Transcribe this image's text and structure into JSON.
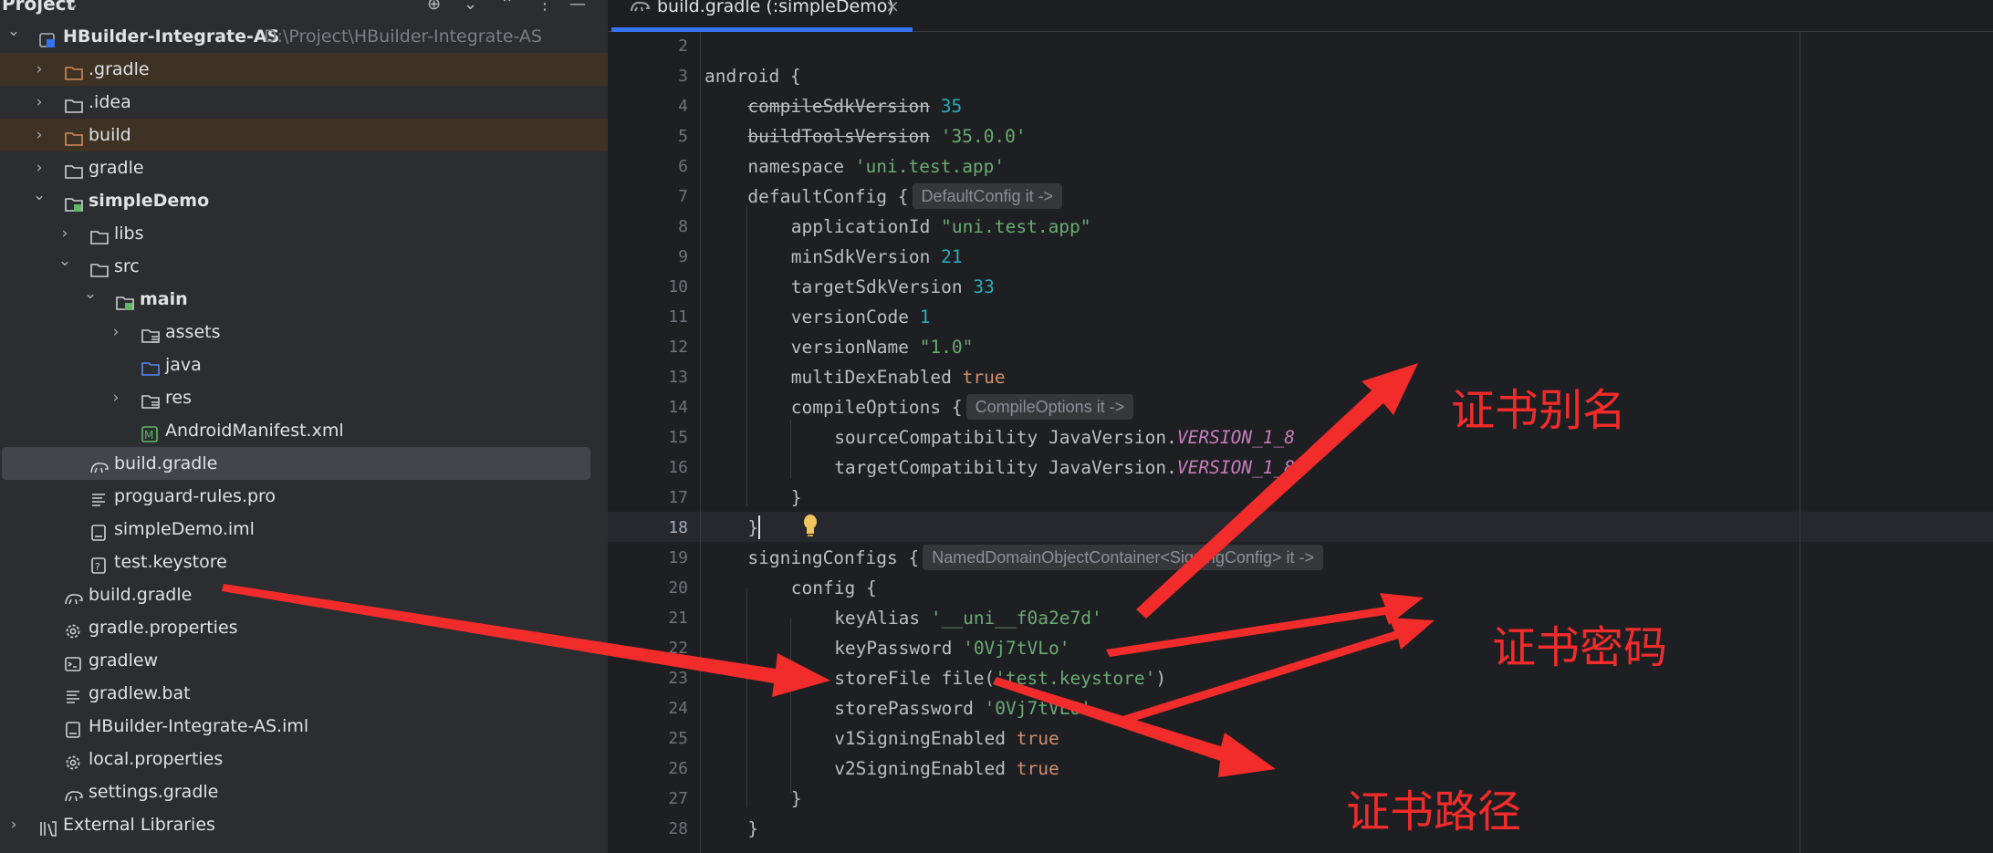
{
  "project_panel": {
    "title": "Project",
    "tree": [
      {
        "label": "HBuilder-Integrate-AS",
        "path": "D:\\Project\\HBuilder-Integrate-AS",
        "icon": "module-icon",
        "bold": true,
        "expanded": true
      },
      {
        "label": ".gradle",
        "icon": "folder-orange-icon",
        "collapsed": true,
        "highlight": true
      },
      {
        "label": ".idea",
        "icon": "folder-icon",
        "collapsed": true
      },
      {
        "label": "build",
        "icon": "folder-orange-icon",
        "collapsed": true,
        "highlight": true
      },
      {
        "label": "gradle",
        "icon": "folder-icon",
        "collapsed": true
      },
      {
        "label": "simpleDemo",
        "icon": "module-folder-icon",
        "bold": true,
        "expanded": true
      },
      {
        "label": "libs",
        "icon": "folder-icon",
        "collapsed": true
      },
      {
        "label": "src",
        "icon": "folder-icon",
        "expanded": true
      },
      {
        "label": "main",
        "icon": "source-folder-icon",
        "bold": true,
        "expanded": true
      },
      {
        "label": "assets",
        "icon": "resource-folder-icon",
        "collapsed": true
      },
      {
        "label": "java",
        "icon": "java-folder-icon"
      },
      {
        "label": "res",
        "icon": "resource-folder-icon",
        "collapsed": true
      },
      {
        "label": "AndroidManifest.xml",
        "icon": "manifest-icon"
      },
      {
        "label": "build.gradle",
        "icon": "gradle-icon",
        "selected": true
      },
      {
        "label": "proguard-rules.pro",
        "icon": "text-file-icon"
      },
      {
        "label": "simpleDemo.iml",
        "icon": "iml-file-icon"
      },
      {
        "label": "test.keystore",
        "icon": "unknown-file-icon"
      },
      {
        "label": "build.gradle",
        "icon": "gradle-icon"
      },
      {
        "label": "gradle.properties",
        "icon": "settings-gear-icon"
      },
      {
        "label": "gradlew",
        "icon": "terminal-file-icon"
      },
      {
        "label": "gradlew.bat",
        "icon": "text-file-icon"
      },
      {
        "label": "HBuilder-Integrate-AS.iml",
        "icon": "iml-file-icon"
      },
      {
        "label": "local.properties",
        "icon": "settings-gear-icon"
      },
      {
        "label": "settings.gradle",
        "icon": "gradle-icon"
      },
      {
        "label": "External Libraries",
        "icon": "library-icon",
        "collapsed": true
      }
    ]
  },
  "editor": {
    "tab_label": "build.gradle (:simpleDemo)",
    "current_line": 18,
    "lines": [
      {
        "n": "2",
        "t": []
      },
      {
        "n": "3",
        "t": [
          [
            "",
            "android {"
          ]
        ]
      },
      {
        "n": "4",
        "t": [
          [
            "st",
            "compileSdkVersion"
          ],
          [
            "",
            " "
          ],
          [
            "n",
            "35"
          ]
        ]
      },
      {
        "n": "5",
        "t": [
          [
            "st",
            "buildToolsVersion"
          ],
          [
            "",
            " "
          ],
          [
            "s",
            "'35.0.0'"
          ]
        ]
      },
      {
        "n": "6",
        "t": [
          [
            "",
            "namespace "
          ],
          [
            "s",
            "'uni.test.app'"
          ]
        ]
      },
      {
        "n": "7",
        "t": [
          [
            "",
            "defaultConfig {"
          ],
          [
            "hint",
            "DefaultConfig it ->"
          ]
        ]
      },
      {
        "n": "8",
        "t": [
          [
            "",
            "applicationId "
          ],
          [
            "s",
            "\"uni.test.app\""
          ]
        ]
      },
      {
        "n": "9",
        "t": [
          [
            "",
            "minSdkVersion "
          ],
          [
            "n",
            "21"
          ]
        ]
      },
      {
        "n": "10",
        "t": [
          [
            "",
            "targetSdkVersion "
          ],
          [
            "n",
            "33"
          ]
        ]
      },
      {
        "n": "11",
        "t": [
          [
            "",
            "versionCode "
          ],
          [
            "n",
            "1"
          ]
        ]
      },
      {
        "n": "12",
        "t": [
          [
            "",
            "versionName "
          ],
          [
            "s",
            "\"1.0\""
          ]
        ]
      },
      {
        "n": "13",
        "t": [
          [
            "",
            "multiDexEnabled "
          ],
          [
            "k",
            "true"
          ]
        ]
      },
      {
        "n": "14",
        "t": [
          [
            "",
            "compileOptions {"
          ],
          [
            "hint",
            "CompileOptions it ->"
          ]
        ]
      },
      {
        "n": "15",
        "t": [
          [
            "",
            "sourceCompatibility JavaVersion."
          ],
          [
            "it",
            "VERSION_1_8"
          ]
        ]
      },
      {
        "n": "16",
        "t": [
          [
            "",
            "targetCompatibility JavaVersion."
          ],
          [
            "it",
            "VERSION_1_8"
          ]
        ]
      },
      {
        "n": "17",
        "t": [
          [
            "",
            "}"
          ]
        ]
      },
      {
        "n": "18",
        "t": [
          [
            "",
            "}"
          ]
        ]
      },
      {
        "n": "19",
        "t": [
          [
            "",
            "signingConfigs {"
          ],
          [
            "hint",
            "NamedDomainObjectContainer<SigningConfig> it ->"
          ]
        ]
      },
      {
        "n": "20",
        "t": [
          [
            "",
            "config {"
          ]
        ]
      },
      {
        "n": "21",
        "t": [
          [
            "",
            "keyAlias "
          ],
          [
            "s",
            "'__uni__f0a2e7d'"
          ]
        ]
      },
      {
        "n": "22",
        "t": [
          [
            "",
            "keyPassword "
          ],
          [
            "s",
            "'0Vj7tVLo'"
          ]
        ]
      },
      {
        "n": "23",
        "t": [
          [
            "",
            "storeFile file("
          ],
          [
            "s",
            "'test.keystore'"
          ],
          [
            "",
            ")"
          ]
        ]
      },
      {
        "n": "24",
        "t": [
          [
            "",
            "storePassword "
          ],
          [
            "s",
            "'0Vj7tVLo'"
          ]
        ]
      },
      {
        "n": "25",
        "t": [
          [
            "",
            "v1SigningEnabled "
          ],
          [
            "k",
            "true"
          ]
        ]
      },
      {
        "n": "26",
        "t": [
          [
            "",
            "v2SigningEnabled "
          ],
          [
            "k",
            "true"
          ]
        ]
      },
      {
        "n": "27",
        "t": [
          [
            "",
            "}"
          ]
        ]
      },
      {
        "n": "28",
        "t": [
          [
            "",
            "}"
          ]
        ]
      }
    ]
  },
  "annotations": {
    "alias": "证书别名",
    "password": "证书密码",
    "path": "证书路径",
    "color": "#f22b2b"
  }
}
